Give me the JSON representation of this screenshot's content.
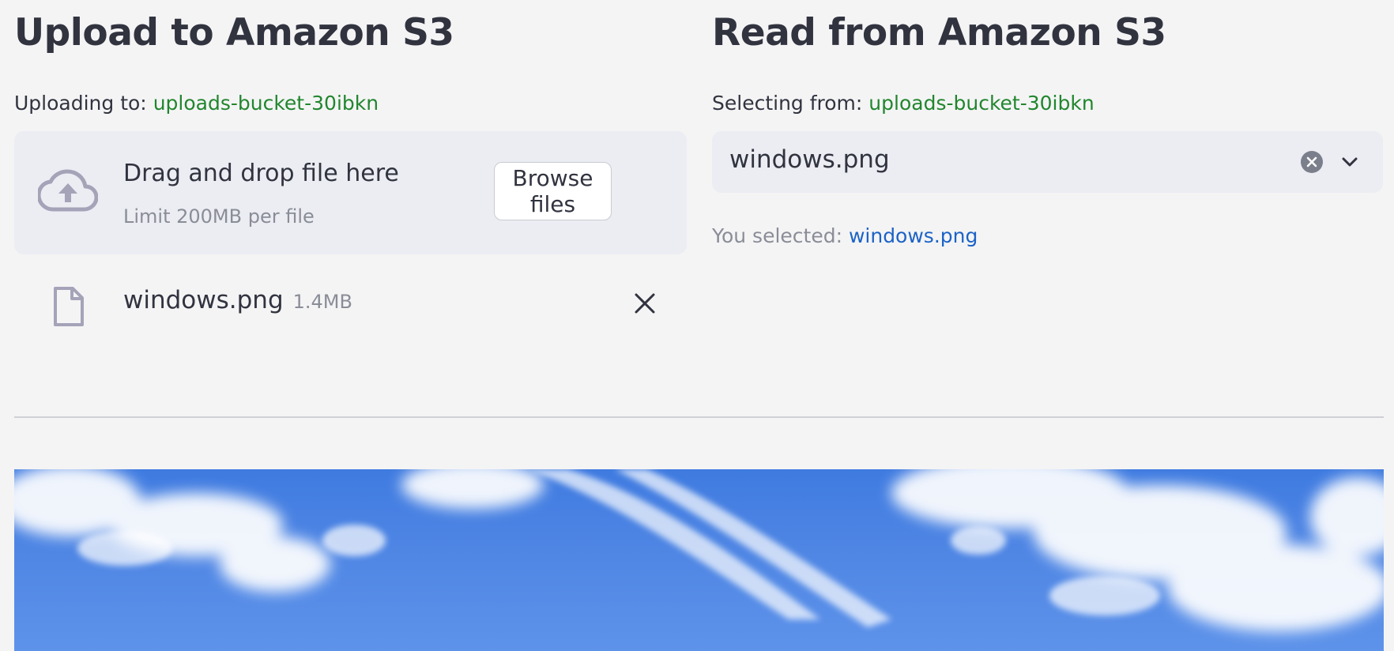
{
  "upload": {
    "heading": "Upload to Amazon S3",
    "caption_prefix": "Uploading to:",
    "bucket": "uploads-bucket-30ibkn",
    "dropzone": {
      "title": "Drag and drop file here",
      "limit": "Limit 200MB per file",
      "icon": "cloud-upload-icon",
      "browse_label": "Browse files"
    },
    "file": {
      "name": "windows.png",
      "size": "1.4MB",
      "icon": "file-icon"
    }
  },
  "read": {
    "heading": "Read from Amazon S3",
    "caption_prefix": "Selecting from:",
    "bucket": "uploads-bucket-30ibkn",
    "select": {
      "value": "windows.png"
    },
    "selected_prefix": "You selected:",
    "selected_file": "windows.png"
  },
  "colors": {
    "background": "#f4f4f5",
    "bucket_green": "#21862d",
    "selected_blue": "#1c63c6",
    "muted_text": "#8a8d97",
    "panel": "#ebedf3",
    "sky": "#3f7be0"
  }
}
